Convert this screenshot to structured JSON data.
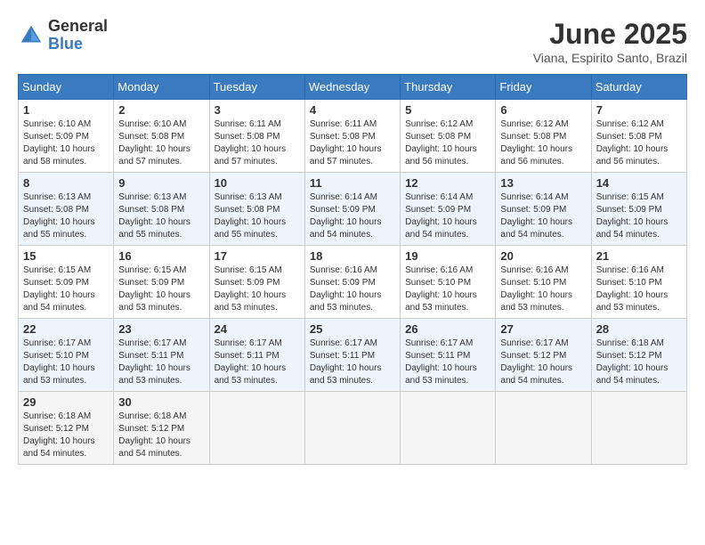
{
  "header": {
    "logo": {
      "line1": "General",
      "line2": "Blue"
    },
    "month": "June 2025",
    "location": "Viana, Espirito Santo, Brazil"
  },
  "weekdays": [
    "Sunday",
    "Monday",
    "Tuesday",
    "Wednesday",
    "Thursday",
    "Friday",
    "Saturday"
  ],
  "weeks": [
    [
      {
        "day": 1,
        "sunrise": "6:10 AM",
        "sunset": "5:09 PM",
        "daylight": "10 hours and 58 minutes."
      },
      {
        "day": 2,
        "sunrise": "6:10 AM",
        "sunset": "5:08 PM",
        "daylight": "10 hours and 57 minutes."
      },
      {
        "day": 3,
        "sunrise": "6:11 AM",
        "sunset": "5:08 PM",
        "daylight": "10 hours and 57 minutes."
      },
      {
        "day": 4,
        "sunrise": "6:11 AM",
        "sunset": "5:08 PM",
        "daylight": "10 hours and 57 minutes."
      },
      {
        "day": 5,
        "sunrise": "6:12 AM",
        "sunset": "5:08 PM",
        "daylight": "10 hours and 56 minutes."
      },
      {
        "day": 6,
        "sunrise": "6:12 AM",
        "sunset": "5:08 PM",
        "daylight": "10 hours and 56 minutes."
      },
      {
        "day": 7,
        "sunrise": "6:12 AM",
        "sunset": "5:08 PM",
        "daylight": "10 hours and 56 minutes."
      }
    ],
    [
      {
        "day": 8,
        "sunrise": "6:13 AM",
        "sunset": "5:08 PM",
        "daylight": "10 hours and 55 minutes."
      },
      {
        "day": 9,
        "sunrise": "6:13 AM",
        "sunset": "5:08 PM",
        "daylight": "10 hours and 55 minutes."
      },
      {
        "day": 10,
        "sunrise": "6:13 AM",
        "sunset": "5:08 PM",
        "daylight": "10 hours and 55 minutes."
      },
      {
        "day": 11,
        "sunrise": "6:14 AM",
        "sunset": "5:09 PM",
        "daylight": "10 hours and 54 minutes."
      },
      {
        "day": 12,
        "sunrise": "6:14 AM",
        "sunset": "5:09 PM",
        "daylight": "10 hours and 54 minutes."
      },
      {
        "day": 13,
        "sunrise": "6:14 AM",
        "sunset": "5:09 PM",
        "daylight": "10 hours and 54 minutes."
      },
      {
        "day": 14,
        "sunrise": "6:15 AM",
        "sunset": "5:09 PM",
        "daylight": "10 hours and 54 minutes."
      }
    ],
    [
      {
        "day": 15,
        "sunrise": "6:15 AM",
        "sunset": "5:09 PM",
        "daylight": "10 hours and 54 minutes."
      },
      {
        "day": 16,
        "sunrise": "6:15 AM",
        "sunset": "5:09 PM",
        "daylight": "10 hours and 53 minutes."
      },
      {
        "day": 17,
        "sunrise": "6:15 AM",
        "sunset": "5:09 PM",
        "daylight": "10 hours and 53 minutes."
      },
      {
        "day": 18,
        "sunrise": "6:16 AM",
        "sunset": "5:09 PM",
        "daylight": "10 hours and 53 minutes."
      },
      {
        "day": 19,
        "sunrise": "6:16 AM",
        "sunset": "5:10 PM",
        "daylight": "10 hours and 53 minutes."
      },
      {
        "day": 20,
        "sunrise": "6:16 AM",
        "sunset": "5:10 PM",
        "daylight": "10 hours and 53 minutes."
      },
      {
        "day": 21,
        "sunrise": "6:16 AM",
        "sunset": "5:10 PM",
        "daylight": "10 hours and 53 minutes."
      }
    ],
    [
      {
        "day": 22,
        "sunrise": "6:17 AM",
        "sunset": "5:10 PM",
        "daylight": "10 hours and 53 minutes."
      },
      {
        "day": 23,
        "sunrise": "6:17 AM",
        "sunset": "5:11 PM",
        "daylight": "10 hours and 53 minutes."
      },
      {
        "day": 24,
        "sunrise": "6:17 AM",
        "sunset": "5:11 PM",
        "daylight": "10 hours and 53 minutes."
      },
      {
        "day": 25,
        "sunrise": "6:17 AM",
        "sunset": "5:11 PM",
        "daylight": "10 hours and 53 minutes."
      },
      {
        "day": 26,
        "sunrise": "6:17 AM",
        "sunset": "5:11 PM",
        "daylight": "10 hours and 53 minutes."
      },
      {
        "day": 27,
        "sunrise": "6:17 AM",
        "sunset": "5:12 PM",
        "daylight": "10 hours and 54 minutes."
      },
      {
        "day": 28,
        "sunrise": "6:18 AM",
        "sunset": "5:12 PM",
        "daylight": "10 hours and 54 minutes."
      }
    ],
    [
      {
        "day": 29,
        "sunrise": "6:18 AM",
        "sunset": "5:12 PM",
        "daylight": "10 hours and 54 minutes."
      },
      {
        "day": 30,
        "sunrise": "6:18 AM",
        "sunset": "5:12 PM",
        "daylight": "10 hours and 54 minutes."
      },
      null,
      null,
      null,
      null,
      null
    ]
  ]
}
